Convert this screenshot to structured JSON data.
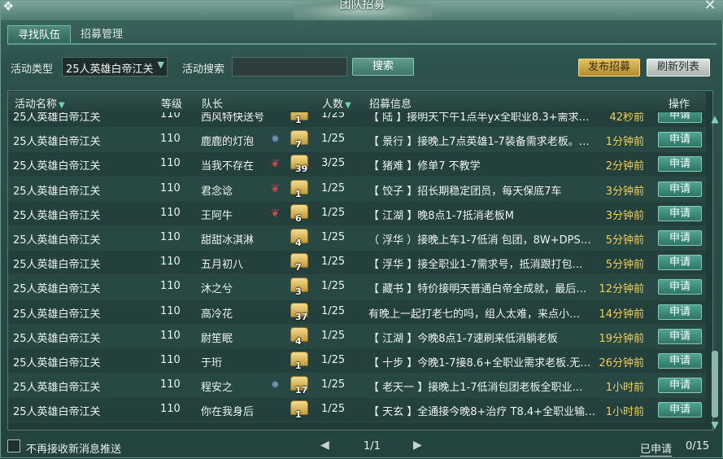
{
  "window": {
    "title": "团队招募"
  },
  "tabs": [
    {
      "label": "寻找队伍",
      "active": true
    },
    {
      "label": "招募管理",
      "active": false
    }
  ],
  "filters": {
    "activity_type_label": "活动类型",
    "activity_type_value": "25人英雄白帝江关",
    "search_label": "活动搜索",
    "search_value": "",
    "search_button": "搜索",
    "publish_button": "发布招募",
    "refresh_button": "刷新列表"
  },
  "table": {
    "headers": {
      "name": "活动名称",
      "level": "等级",
      "leader": "队长",
      "count": "人数",
      "info": "招募信息",
      "action": "操作"
    },
    "apply_label": "申请",
    "rows": [
      {
        "name": "25人英雄白帝江关",
        "level": "110",
        "leader": "西风特快送号",
        "sect": "none",
        "crown": "1",
        "count": "1/25",
        "info": "【 陆 】接明天下午1点半yx全职业8.3+需求…",
        "time": "42秒前"
      },
      {
        "name": "25人英雄白帝江关",
        "level": "110",
        "leader": "鹿鹿的灯泡",
        "sect": "blue",
        "crown": "7",
        "count": "1/25",
        "info": "【 景行 】接晚上7点英雄1-7装备需求老板。…",
        "time": "1分钟前"
      },
      {
        "name": "25人英雄白帝江关",
        "level": "110",
        "leader": "当我不存在",
        "sect": "red",
        "crown": "39",
        "count": "3/25",
        "info": "【 猪难 】修单7 不教学",
        "time": "2分钟前"
      },
      {
        "name": "25人英雄白帝江关",
        "level": "110",
        "leader": "君念谂",
        "sect": "red",
        "crown": "1",
        "count": "1/25",
        "info": "【 饺子 】招长期稳定团员，每天保底7车",
        "time": "3分钟前"
      },
      {
        "name": "25人英雄白帝江关",
        "level": "110",
        "leader": "王阿牛",
        "sect": "red",
        "crown": "6",
        "count": "1/25",
        "info": "【 江湖 】晚8点1-7抵消老板M",
        "time": "3分钟前"
      },
      {
        "name": "25人英雄白帝江关",
        "level": "110",
        "leader": "甜甜冰淇淋",
        "sect": "none",
        "crown": "4",
        "count": "1/25",
        "info": "（ 浮华 ）接晚上车1-7低消 包团，8W+DPS…",
        "time": "5分钟前"
      },
      {
        "name": "25人英雄白帝江关",
        "level": "110",
        "leader": "五月初八",
        "sect": "none",
        "crown": "7",
        "count": "1/25",
        "info": "【 浮华 】接全职业1-7需求号，抵消跟打包…",
        "time": "5分钟前"
      },
      {
        "name": "25人英雄白帝江关",
        "level": "110",
        "leader": "沐之兮",
        "sect": "none",
        "crown": "3",
        "count": "1/25",
        "info": "【 藏书 】特价接明天普通白帝全成就，最后…",
        "time": "12分钟前"
      },
      {
        "name": "25人英雄白帝江关",
        "level": "110",
        "leader": "高冷花",
        "sect": "none",
        "crown": "37",
        "count": "1/25",
        "info": "有晚上一起打老七的吗，组人太难，来点小…",
        "time": "14分钟前"
      },
      {
        "name": "25人英雄白帝江关",
        "level": "110",
        "leader": "尉笙眠",
        "sect": "none",
        "crown": "4",
        "count": "1/25",
        "info": "【 江湖 】今晚8点1-7速刷来低消躺老板",
        "time": "19分钟前"
      },
      {
        "name": "25人英雄白帝江关",
        "level": "110",
        "leader": "于珩",
        "sect": "none",
        "crown": "1",
        "count": "1/25",
        "info": "【 十步 】今晚1-7接8.6+全职业需求老板.无…",
        "time": "26分钟前"
      },
      {
        "name": "25人英雄白帝江关",
        "level": "110",
        "leader": "程安之",
        "sect": "blue",
        "crown": "17",
        "count": "1/25",
        "info": "【 老天一 】接晚上1-7低消包团老板全职业…",
        "time": "1小时前"
      },
      {
        "name": "25人英雄白帝江关",
        "level": "110",
        "leader": "你在我身后",
        "sect": "none",
        "crown": "1",
        "count": "1/25",
        "info": "【 天玄 】全通接今晚8+治疗 T8.4+全职业输…",
        "time": "1小时前"
      }
    ]
  },
  "footer": {
    "checkbox_label": "不再接收新消息推送",
    "page": "1/1",
    "applied_label": "已申请",
    "applied_count": "0/15"
  },
  "colors": {
    "accent": "#4fa393",
    "time": "#f2cf56",
    "gold_button": "#e1c25e"
  }
}
